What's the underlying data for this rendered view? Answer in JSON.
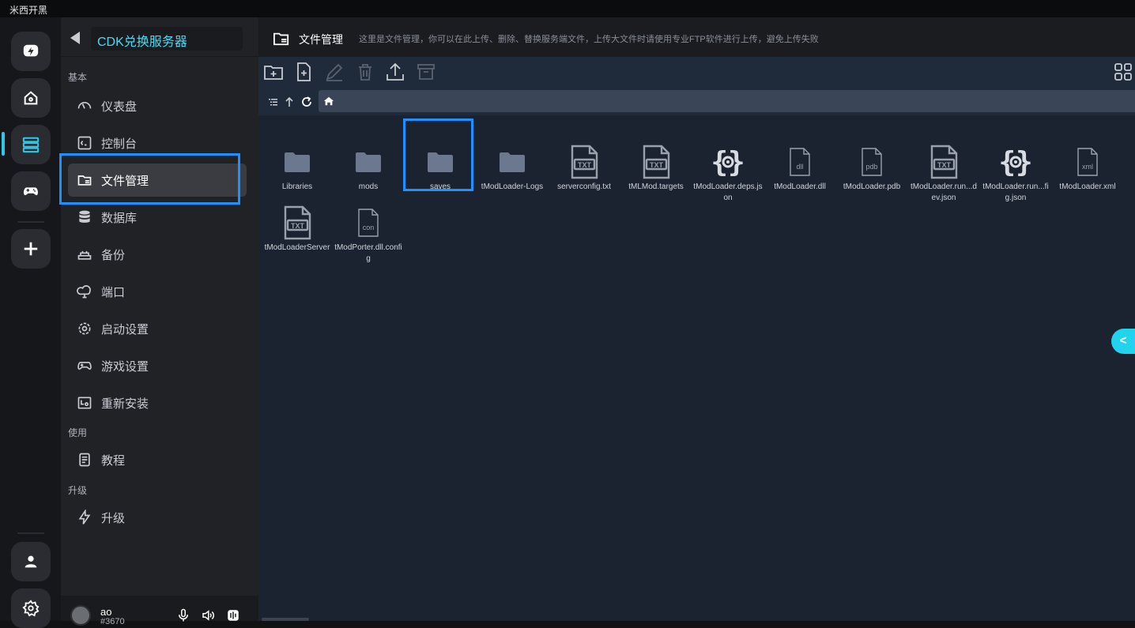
{
  "window": {
    "title": "米西开黑"
  },
  "rail": {
    "items": [
      {
        "name": "brand-logo-icon"
      },
      {
        "name": "home-icon"
      },
      {
        "name": "servers-icon"
      },
      {
        "name": "gamepad-icon"
      },
      {
        "name": "add-icon"
      },
      {
        "name": "user-icon"
      },
      {
        "name": "settings-icon"
      }
    ],
    "accent": "#30c7e8"
  },
  "sidebar": {
    "server_name": "CDK兑换服务器",
    "sections": {
      "basic": "基本",
      "usage": "使用",
      "upgrade": "升级"
    },
    "items": [
      {
        "label": "仪表盘",
        "icon": "dashboard-icon"
      },
      {
        "label": "控制台",
        "icon": "console-icon"
      },
      {
        "label": "文件管理",
        "icon": "folder-manage-icon",
        "active": true
      },
      {
        "label": "数据库",
        "icon": "database-icon"
      },
      {
        "label": "备份",
        "icon": "backup-icon"
      },
      {
        "label": "端口",
        "icon": "cloud-port-icon"
      },
      {
        "label": "启动设置",
        "icon": "gear-icon"
      },
      {
        "label": "游戏设置",
        "icon": "gamepad-icon"
      },
      {
        "label": "重新安装",
        "icon": "reinstall-icon"
      },
      {
        "label": "教程",
        "icon": "document-icon"
      },
      {
        "label": "升级",
        "icon": "lightning-icon"
      }
    ],
    "user": {
      "name": "ao",
      "tag": "#3670"
    }
  },
  "main": {
    "title": "文件管理",
    "description": "这里是文件管理，你可以在此上传、删除、替换服务端文件，上传大文件时请使用专业FTP软件进行上传，避免上传失败",
    "toolbar": [
      "new-folder-icon",
      "new-file-icon",
      "edit-icon",
      "delete-icon",
      "upload-icon",
      "archive-icon"
    ],
    "files": [
      {
        "name": "Libraries",
        "kind": "folder"
      },
      {
        "name": "mods",
        "kind": "folder"
      },
      {
        "name": "saves",
        "kind": "folder",
        "selected": true
      },
      {
        "name": "tModLoader-Logs",
        "kind": "folder"
      },
      {
        "name": "serverconfig.txt",
        "kind": "txt"
      },
      {
        "name": "tMLMod.targets",
        "kind": "txt"
      },
      {
        "name": "tModLoader.deps.json",
        "kind": "json"
      },
      {
        "name": "tModLoader.dll",
        "kind": "ext",
        "ext": "dll"
      },
      {
        "name": "tModLoader.pdb",
        "kind": "ext",
        "ext": "pdb"
      },
      {
        "name": "tModLoader.run...dev.json",
        "kind": "txt"
      },
      {
        "name": "tModLoader.run...fig.json",
        "kind": "json"
      },
      {
        "name": "tModLoader.xml",
        "kind": "ext",
        "ext": "xml"
      },
      {
        "name": "tModLoaderServer",
        "kind": "txt"
      },
      {
        "name": "tModPorter.dll.config",
        "kind": "ext",
        "ext": "con"
      }
    ],
    "side_toggle": "<"
  },
  "colors": {
    "highlight": "#1e90ff",
    "server_name": "#4fd8f2",
    "toggle": "#22d3ee"
  }
}
